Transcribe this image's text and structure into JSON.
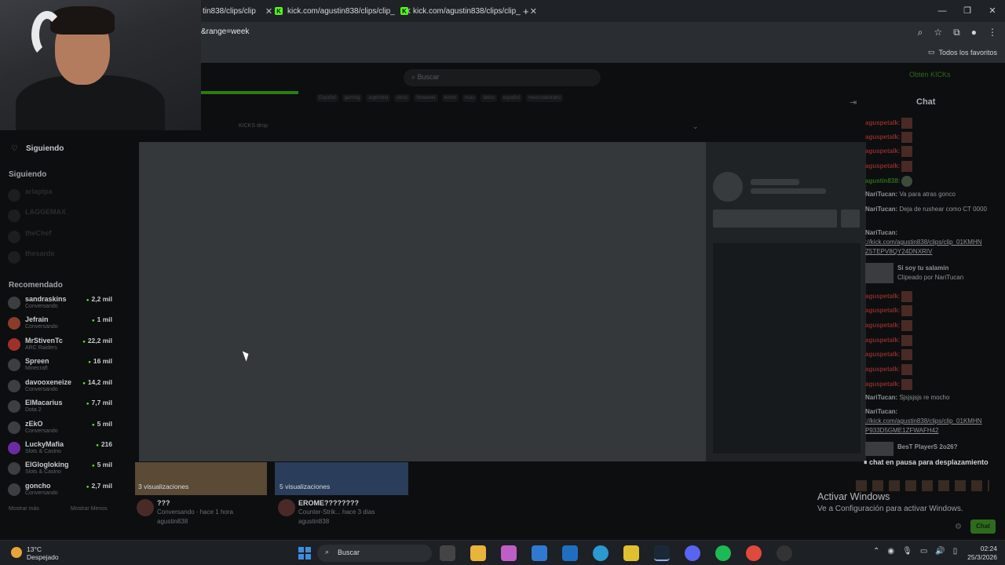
{
  "browser": {
    "tabs": [
      {
        "label": "tin838/clips/clip"
      },
      {
        "label": "kick.com/agustin838/clips/clip_"
      },
      {
        "label": "kick.com/agustin838/clips/clip_"
      }
    ],
    "new_tab": "+",
    "url_fragment": "&range=week",
    "bookmarks_label": "Todos los favoritos"
  },
  "kick": {
    "search_placeholder": "Buscar",
    "obtain_label": "Obtén KICKs",
    "kicks_drop": "KICKS drop",
    "tags": [
      "Español",
      "gaming",
      "argentina",
      "skins",
      "Streamer",
      "tenrol",
      "risas",
      "latino",
      "español",
      "mexicoadorado"
    ],
    "following_header": "Siguiendo",
    "following_section": "Siguiendo",
    "recommended_section": "Recomendado",
    "following": [
      {
        "name": "ariapipa"
      },
      {
        "name": "LAGGEMAX"
      },
      {
        "name": "theChef"
      },
      {
        "name": "thesarde"
      }
    ],
    "recommended": [
      {
        "name": "sandraskins",
        "category": "Conversando",
        "viewers": "2,2 mil"
      },
      {
        "name": "Jefrain",
        "category": "Conversando",
        "viewers": "1 mil"
      },
      {
        "name": "MrStivenTc",
        "category": "ARC Raiders",
        "viewers": "22,2 mil"
      },
      {
        "name": "Spreen",
        "category": "Minecraft",
        "viewers": "16 mil"
      },
      {
        "name": "davooxeneize",
        "category": "Conversando",
        "viewers": "14,2 mil"
      },
      {
        "name": "ElMacarius",
        "category": "Dota 2",
        "viewers": "7,7 mil"
      },
      {
        "name": "zEkO",
        "category": "Conversando",
        "viewers": "5 mil"
      },
      {
        "name": "LuckyMafia",
        "category": "Slots & Casino",
        "viewers": "216"
      },
      {
        "name": "ElGlogloking",
        "category": "Slots & Casino",
        "viewers": "5 mil"
      },
      {
        "name": "goncho",
        "category": "Conversando",
        "viewers": "2,7 mil"
      }
    ],
    "show_more": "Mostrar más",
    "show_less": "Mostrar Menos",
    "clips": [
      {
        "views": "3 visualizaciones",
        "title": "???",
        "sub": "Conversando · hace 1 hora",
        "author": "agustin838"
      },
      {
        "views": "5 visualizaciones",
        "title": "EROME????????",
        "sub": "Counter-Strik...    hace 3 días",
        "author": "agustin838"
      }
    ]
  },
  "chat": {
    "title": "Chat",
    "messages": [
      {
        "user": "aguspetalk:",
        "text": "",
        "emote": true
      },
      {
        "user": "aguspetalk:",
        "text": "",
        "emote": true
      },
      {
        "user": "aguspetalk:",
        "text": "",
        "emote": true
      },
      {
        "user": "aguspetalk:",
        "text": "",
        "emote": true
      },
      {
        "user": "agustin838:",
        "text": "",
        "emote": false
      },
      {
        "user": "NariTucan:",
        "text": "Va para atras gonco",
        "emote": false
      },
      {
        "user": "NariTucan:",
        "text": "Deja de rushear como CT 0000",
        "emote": false
      },
      {
        "user": "NariTucan:",
        "text": "://kick.com/agustin838/clips/clip_01KMHN Z5TEPV8QY24DNXRIV",
        "emote": false
      }
    ],
    "clip_card_1": {
      "title": "Si soy tu salamin",
      "sub": "Clipeado por NariTucan"
    },
    "messages_2": [
      {
        "user": "NariTucan:",
        "text": "Sjsjsjsjs re mocho"
      },
      {
        "user": "NariTucan:",
        "text": "://kick.com/agustin838/clips/clip_01KMHN P933D5GME1ZFWAFH42"
      }
    ],
    "clip_card_2": {
      "title": "BesT PlayerS 2o26?"
    },
    "paused": "chat en pausa para desplazamiento",
    "send_label": "Chat"
  },
  "windows": {
    "activate_title": "Activar Windows",
    "activate_sub": "Ve a Configuración para activar Windows.",
    "weather_temp": "13°C",
    "weather_desc": "Despejado",
    "search_label": "Buscar",
    "time": "02:24",
    "date": "25/3/2026"
  },
  "colors": {
    "kick_green": "#53fc18",
    "overlay": "#35383b"
  }
}
